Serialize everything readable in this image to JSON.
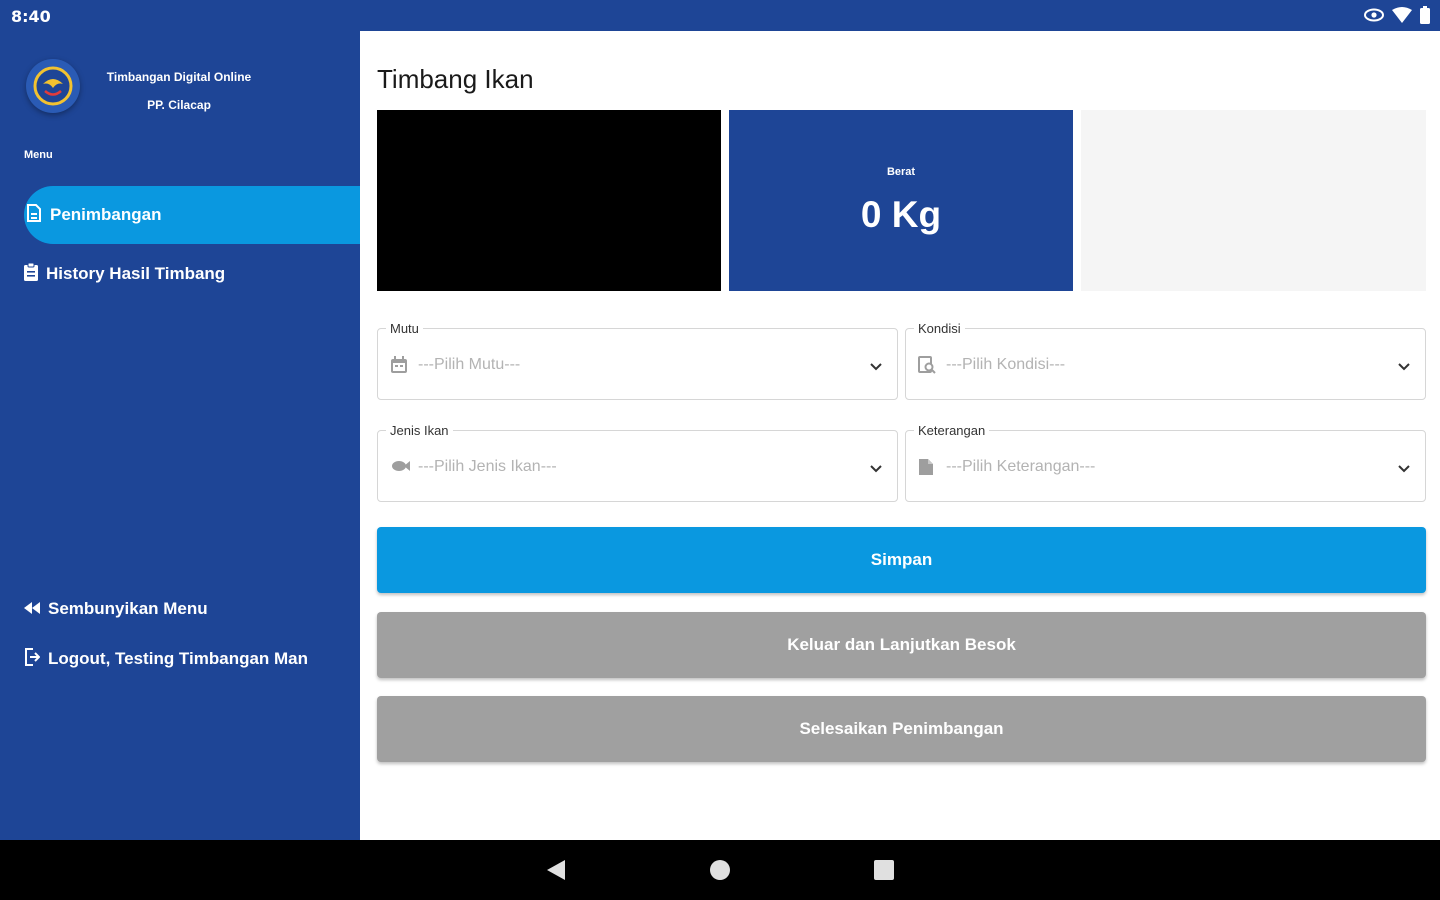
{
  "status_bar": {
    "time": "8:40",
    "icons": [
      "eye-icon",
      "wifi-icon",
      "battery-icon"
    ]
  },
  "sidebar": {
    "app_title_line1": "Timbangan Digital Online",
    "app_title_line2": "PP. Cilacap",
    "menu_label": "Menu",
    "items": [
      {
        "label": "Penimbangan",
        "icon": "scale-doc-icon",
        "active": true
      },
      {
        "label": "History Hasil Timbang",
        "icon": "clipboard-icon",
        "active": false
      }
    ],
    "hide_menu_label": "Sembunyikan Menu",
    "logout_label": "Logout, Testing Timbangan Man"
  },
  "main": {
    "title": "Timbang Ikan",
    "weight_label": "Berat",
    "weight_value": "0 Kg",
    "fields": {
      "mutu": {
        "label": "Mutu",
        "placeholder": "---Pilih Mutu---",
        "icon": "calendar-icon"
      },
      "kondisi": {
        "label": "Kondisi",
        "placeholder": "---Pilih Kondisi---",
        "icon": "search-doc-icon"
      },
      "jenis_ikan": {
        "label": "Jenis Ikan",
        "placeholder": "---Pilih Jenis Ikan---",
        "icon": "fish-icon"
      },
      "keterangan": {
        "label": "Keterangan",
        "placeholder": "---Pilih Keterangan---",
        "icon": "document-icon"
      }
    },
    "buttons": {
      "simpan": "Simpan",
      "keluar": "Keluar dan Lanjutkan Besok",
      "selesai": "Selesaikan Penimbangan"
    }
  },
  "colors": {
    "primary": "#1e4596",
    "accent": "#0a98e0",
    "disabled": "#a0a0a0"
  }
}
